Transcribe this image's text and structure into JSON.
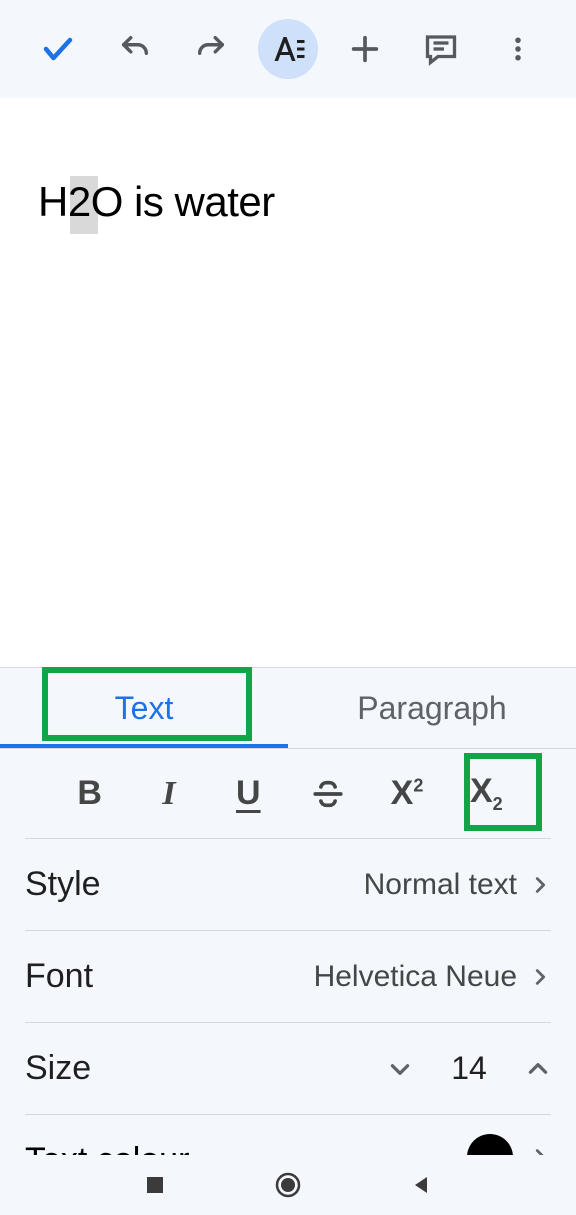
{
  "toolbar": {
    "icons": {
      "check": "check-icon",
      "undo": "undo-icon",
      "redo": "redo-icon",
      "format": "format-icon",
      "plus": "plus-icon",
      "comment": "comment-icon",
      "more": "more-icon"
    }
  },
  "document": {
    "content": "H2O is water"
  },
  "panel": {
    "tabs": {
      "text": "Text",
      "paragraph": "Paragraph"
    },
    "active_tab": "text",
    "format_buttons": {
      "bold": "B",
      "italic": "I",
      "underline": "U",
      "strike": "S",
      "superscript": "X²",
      "subscript": "X₂"
    },
    "style": {
      "label": "Style",
      "value": "Normal text"
    },
    "font": {
      "label": "Font",
      "value": "Helvetica Neue"
    },
    "size": {
      "label": "Size",
      "value": "14"
    },
    "text_colour": {
      "label": "Text colour",
      "value": "#000000"
    }
  },
  "annotations": {
    "highlight_text_tab": true,
    "highlight_subscript": true
  }
}
